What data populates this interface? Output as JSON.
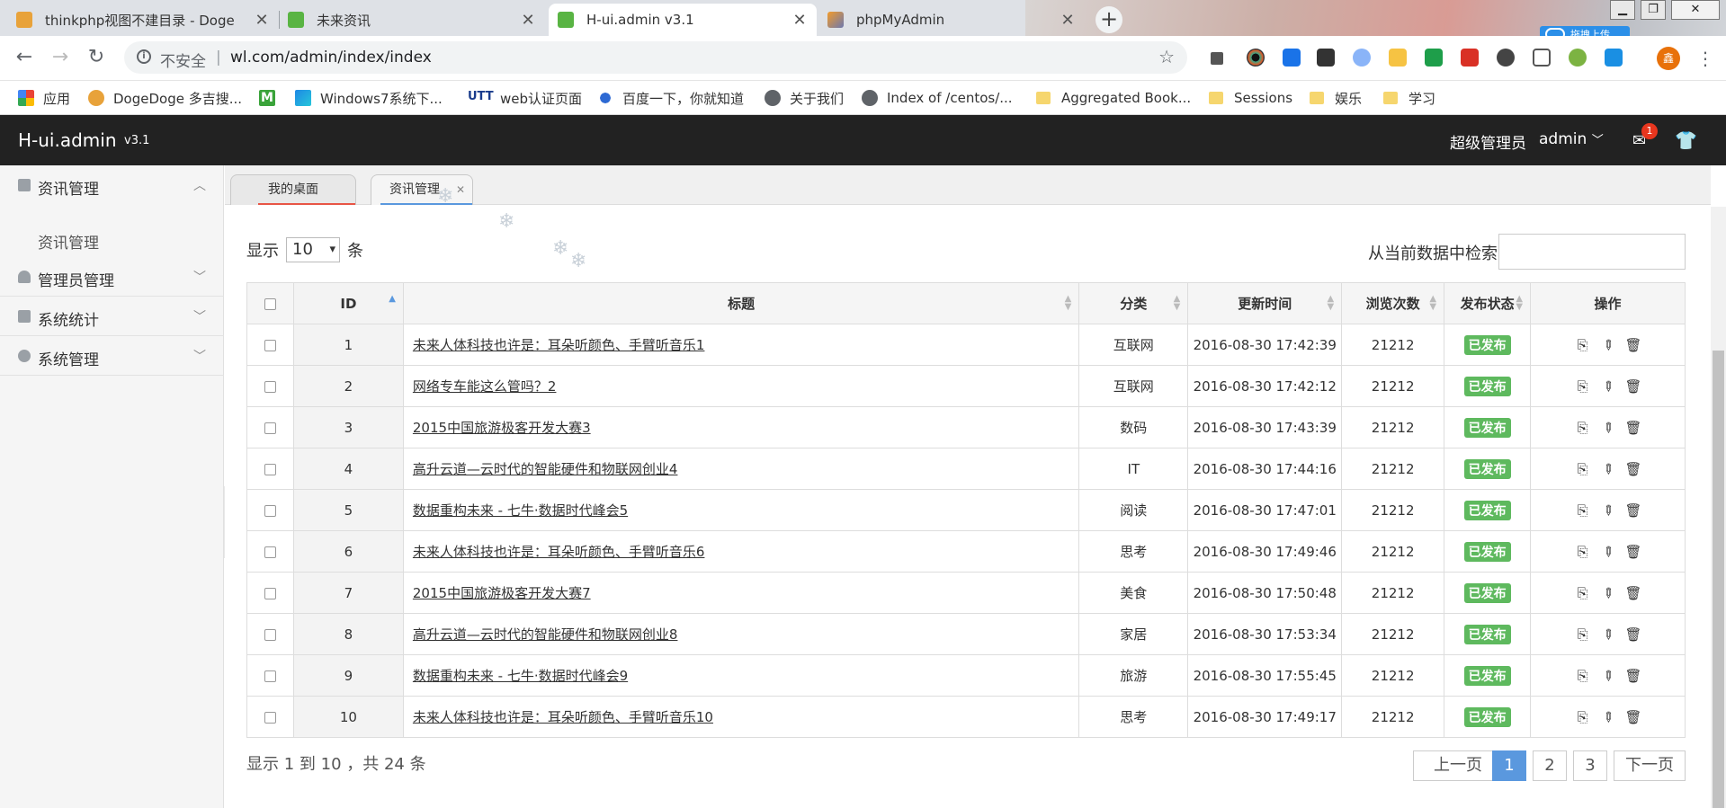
{
  "browser": {
    "tabs": [
      {
        "title": "thinkphp视图不建目录 - Doge",
        "active": false
      },
      {
        "title": "未来资讯",
        "active": false
      },
      {
        "title": "H-ui.admin v3.1",
        "active": true
      },
      {
        "title": "phpMyAdmin",
        "active": false
      }
    ],
    "insecure_label": "不安全",
    "url": "wl.com/admin/index/index",
    "cloud_label": "拖拽上传",
    "profile_initial": "鑫",
    "bookmarks": [
      {
        "label": "应用",
        "icon": "apps-grid-icon"
      },
      {
        "label": "DogeDoge 多吉搜...",
        "icon": "doge-icon"
      },
      {
        "label": "",
        "icon": "m-icon"
      },
      {
        "label": "Windows7系统下...",
        "icon": "windows-icon"
      },
      {
        "label": "web认证页面",
        "icon": "utt-icon"
      },
      {
        "label": "百度一下，你就知道",
        "icon": "baidu-paw-icon"
      },
      {
        "label": "关于我们",
        "icon": "globe-icon"
      },
      {
        "label": "Index of /centos/...",
        "icon": "globe-icon"
      },
      {
        "label": "Aggregated Book...",
        "icon": "folder-icon"
      },
      {
        "label": "Sessions",
        "icon": "folder-icon"
      },
      {
        "label": "娱乐",
        "icon": "folder-icon"
      },
      {
        "label": "学习",
        "icon": "folder-icon"
      }
    ],
    "m_icon_text": "M",
    "utt_icon_text": "UTT"
  },
  "app": {
    "logo": "H-ui.admin",
    "version": "v3.1",
    "role": "超级管理员",
    "user": "admin",
    "mail_count": "1",
    "sidebar": [
      {
        "label": "资讯管理",
        "expanded": true,
        "icon": "news-icon"
      },
      {
        "label": "管理员管理",
        "expanded": false,
        "icon": "user-icon"
      },
      {
        "label": "系统统计",
        "expanded": false,
        "icon": "stats-icon"
      },
      {
        "label": "系统管理",
        "expanded": false,
        "icon": "gear-icon"
      }
    ],
    "sidebar_sub": "资讯管理",
    "tabs": [
      {
        "label": "我的桌面"
      },
      {
        "label": "资讯管理"
      }
    ]
  },
  "list": {
    "show_prefix": "显示",
    "page_size": "10",
    "show_suffix": "条",
    "search_label": "从当前数据中检索:",
    "columns": [
      "ID",
      "标题",
      "分类",
      "更新时间",
      "浏览次数",
      "发布状态",
      "操作"
    ],
    "rows": [
      {
        "id": "1",
        "title": "未来人体科技也许是：耳朵听颜色、手臂听音乐1",
        "category": "互联网",
        "time": "2016-08-30 17:42:39",
        "views": "21212",
        "status": "已发布"
      },
      {
        "id": "2",
        "title": "网络专车能这么管吗？2",
        "category": "互联网",
        "time": "2016-08-30 17:42:12",
        "views": "21212",
        "status": "已发布"
      },
      {
        "id": "3",
        "title": "2015中国旅游极客开发大赛3",
        "category": "数码",
        "time": "2016-08-30 17:43:39",
        "views": "21212",
        "status": "已发布"
      },
      {
        "id": "4",
        "title": "高升云道—云时代的智能硬件和物联网创业4",
        "category": "IT",
        "time": "2016-08-30 17:44:16",
        "views": "21212",
        "status": "已发布"
      },
      {
        "id": "5",
        "title": "数据重构未来 - 七牛·数据时代峰会5",
        "category": "阅读",
        "time": "2016-08-30 17:47:01",
        "views": "21212",
        "status": "已发布"
      },
      {
        "id": "6",
        "title": "未来人体科技也许是：耳朵听颜色、手臂听音乐6",
        "category": "思考",
        "time": "2016-08-30 17:49:46",
        "views": "21212",
        "status": "已发布"
      },
      {
        "id": "7",
        "title": "2015中国旅游极客开发大赛7",
        "category": "美食",
        "time": "2016-08-30 17:50:48",
        "views": "21212",
        "status": "已发布"
      },
      {
        "id": "8",
        "title": "高升云道—云时代的智能硬件和物联网创业8",
        "category": "家居",
        "time": "2016-08-30 17:53:34",
        "views": "21212",
        "status": "已发布"
      },
      {
        "id": "9",
        "title": "数据重构未来 - 七牛·数据时代峰会9",
        "category": "旅游",
        "time": "2016-08-30 17:55:45",
        "views": "21212",
        "status": "已发布"
      },
      {
        "id": "10",
        "title": "未来人体科技也许是：耳朵听颜色、手臂听音乐10",
        "category": "思考",
        "time": "2016-08-30 17:49:17",
        "views": "21212",
        "status": "已发布"
      }
    ],
    "info": "显示 1 到 10 ，共 24 条",
    "pager": {
      "prev": "上一页",
      "pages": [
        "1",
        "2",
        "3"
      ],
      "current": "1",
      "next": "下一页"
    }
  },
  "colors": {
    "accent": "#5a98de",
    "published": "#5eb95e",
    "header": "#222222",
    "badge": "#e8361e"
  }
}
